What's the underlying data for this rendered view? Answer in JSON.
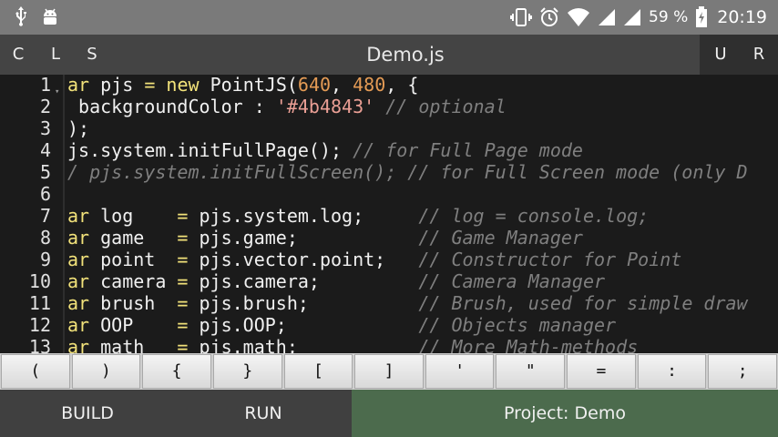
{
  "status_bar": {
    "battery_percent": "59 %",
    "time": "20:19",
    "icons": [
      "usb-icon",
      "android-icon",
      "vibrate-icon",
      "alarm-icon",
      "wifi-icon",
      "signal-icon",
      "signal-icon",
      "battery-charging-icon"
    ]
  },
  "toolbar": {
    "left_buttons": [
      "C",
      "L",
      "S"
    ],
    "title": "Demo.js",
    "right_buttons": [
      "U",
      "R"
    ]
  },
  "editor": {
    "lines": [
      {
        "n": "1",
        "tokens": [
          [
            "kw",
            "ar"
          ],
          [
            "fn",
            " pjs "
          ],
          [
            "kw",
            "="
          ],
          [
            "kw",
            " new"
          ],
          [
            "fn",
            " PointJS("
          ],
          [
            "num",
            "640"
          ],
          [
            "fn",
            ", "
          ],
          [
            "num",
            "480"
          ],
          [
            "fn",
            ", {"
          ]
        ]
      },
      {
        "n": "2",
        "tokens": [
          [
            "fn",
            " backgroundColor : "
          ],
          [
            "str",
            "'#4b4843'"
          ],
          [
            "cm",
            " // optional"
          ]
        ]
      },
      {
        "n": "3",
        "tokens": [
          [
            "fn",
            ");"
          ]
        ]
      },
      {
        "n": "4",
        "tokens": [
          [
            "fn",
            "js.system.initFullPage(); "
          ],
          [
            "cm",
            "// for Full Page mode"
          ]
        ]
      },
      {
        "n": "5",
        "tokens": [
          [
            "cm",
            "/ pjs.system.initFullScreen(); // for Full Screen mode (only D"
          ]
        ]
      },
      {
        "n": "6",
        "tokens": [
          [
            "fn",
            ""
          ]
        ]
      },
      {
        "n": "7",
        "tokens": [
          [
            "kw",
            "ar"
          ],
          [
            "fn",
            " log    "
          ],
          [
            "kw",
            "="
          ],
          [
            "fn",
            " pjs.system.log;     "
          ],
          [
            "cm",
            "// log = console.log;"
          ]
        ]
      },
      {
        "n": "8",
        "tokens": [
          [
            "kw",
            "ar"
          ],
          [
            "fn",
            " game   "
          ],
          [
            "kw",
            "="
          ],
          [
            "fn",
            " pjs.game;           "
          ],
          [
            "cm",
            "// Game Manager"
          ]
        ]
      },
      {
        "n": "9",
        "tokens": [
          [
            "kw",
            "ar"
          ],
          [
            "fn",
            " point  "
          ],
          [
            "kw",
            "="
          ],
          [
            "fn",
            " pjs.vector.point;   "
          ],
          [
            "cm",
            "// Constructor for Point"
          ]
        ]
      },
      {
        "n": "10",
        "tokens": [
          [
            "kw",
            "ar"
          ],
          [
            "fn",
            " camera "
          ],
          [
            "kw",
            "="
          ],
          [
            "fn",
            " pjs.camera;         "
          ],
          [
            "cm",
            "// Camera Manager"
          ]
        ]
      },
      {
        "n": "11",
        "tokens": [
          [
            "kw",
            "ar"
          ],
          [
            "fn",
            " brush  "
          ],
          [
            "kw",
            "="
          ],
          [
            "fn",
            " pjs.brush;          "
          ],
          [
            "cm",
            "// Brush, used for simple draw"
          ]
        ]
      },
      {
        "n": "12",
        "tokens": [
          [
            "kw",
            "ar"
          ],
          [
            "fn",
            " OOP    "
          ],
          [
            "kw",
            "="
          ],
          [
            "fn",
            " pjs.OOP;            "
          ],
          [
            "cm",
            "// Objects manager"
          ]
        ]
      },
      {
        "n": "13",
        "tokens": [
          [
            "kw",
            "ar"
          ],
          [
            "fn",
            " math   "
          ],
          [
            "kw",
            "="
          ],
          [
            "fn",
            " pjs.math;           "
          ],
          [
            "cm",
            "// More Math-methods"
          ]
        ]
      }
    ]
  },
  "symbol_bar": [
    "(",
    ")",
    "{",
    "}",
    "[",
    "]",
    "'",
    "\"",
    "=",
    ":",
    ";"
  ],
  "bottom_bar": {
    "build": "BUILD",
    "run": "RUN",
    "project": "Project: Demo"
  }
}
